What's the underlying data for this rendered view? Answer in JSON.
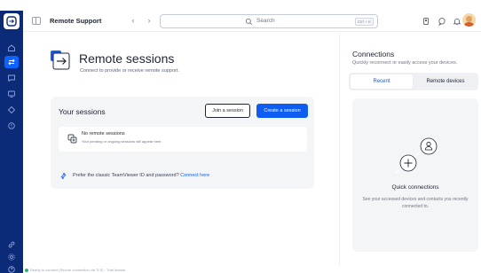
{
  "app": {
    "title": "Remote Support"
  },
  "colors": {
    "rail": "#0b2a78",
    "accent": "#0e5cf0",
    "card": "#f4f5f7"
  },
  "rail": {
    "items": [
      {
        "icon": "home-icon"
      },
      {
        "icon": "remote-support-icon",
        "active": true
      },
      {
        "icon": "chat-icon"
      },
      {
        "icon": "devices-icon"
      },
      {
        "icon": "tag-icon"
      },
      {
        "icon": "alert-icon"
      },
      {
        "icon": "link-icon"
      },
      {
        "icon": "settings-icon"
      },
      {
        "icon": "help-icon"
      }
    ]
  },
  "topbar": {
    "search_placeholder": "Search",
    "search_shortcut": "Ctrl + K"
  },
  "main": {
    "title": "Remote sessions",
    "subtitle": "Connect to provide or receive remote support.",
    "sessions": {
      "title": "Your sessions",
      "join_label": "Join a session",
      "create_label": "Create a session",
      "empty_title": "No remote sessions",
      "empty_sub": "Your pending or ongoing sessions will appear here."
    },
    "classic": {
      "text": "Prefer the classic TeamViewer ID and password?",
      "link": "Connect here"
    }
  },
  "connections": {
    "title": "Connections",
    "subtitle": "Quickly reconnect or easily access your devices.",
    "tabs": [
      {
        "label": "Recent",
        "active": true
      },
      {
        "label": "Remote devices",
        "active": false
      }
    ],
    "quick_title": "Quick connections",
    "quick_sub": "See your accessed devices and contacts you recently connected to."
  },
  "footer": {
    "note": "Ready to connect (Secure connection via TLS) · Trial license"
  }
}
